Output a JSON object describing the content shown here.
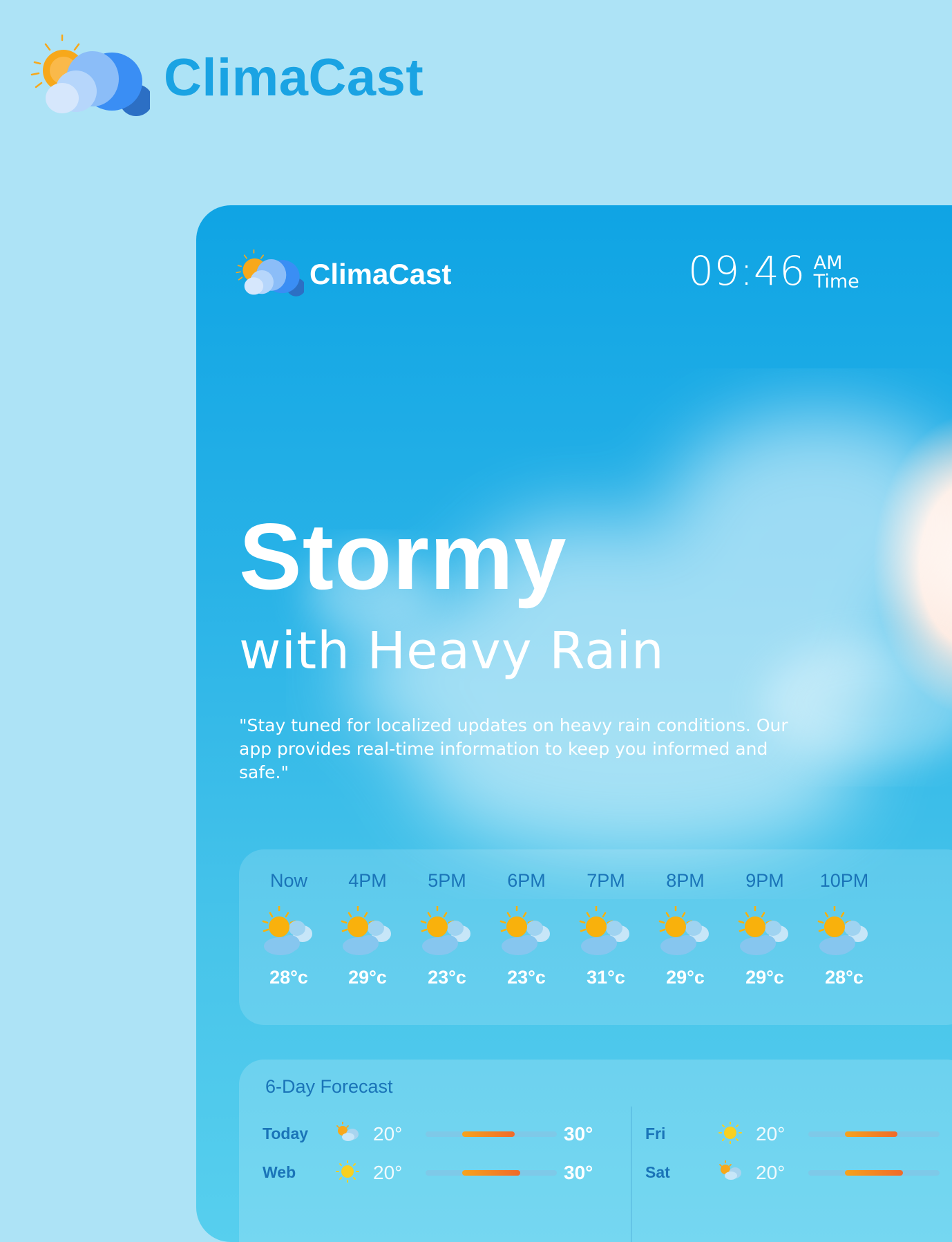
{
  "brand": {
    "name": "ClimaCast"
  },
  "app": {
    "name": "ClimaCast",
    "time": "09:46",
    "period": "AM",
    "time_label": "Time"
  },
  "hero": {
    "condition": "Stormy",
    "subcondition": "with Heavy Rain",
    "quote": "\"Stay tuned for localized updates on heavy rain conditions. Our app provides real-time information to keep you informed and safe.\""
  },
  "hourly": [
    {
      "label": "Now",
      "temp": "28°c",
      "icon": "sun-cloud-icon"
    },
    {
      "label": "4PM",
      "temp": "29°c",
      "icon": "sun-cloud-icon"
    },
    {
      "label": "5PM",
      "temp": "23°c",
      "icon": "sun-cloud-icon"
    },
    {
      "label": "6PM",
      "temp": "23°c",
      "icon": "sun-cloud-icon"
    },
    {
      "label": "7PM",
      "temp": "31°c",
      "icon": "sun-cloud-icon"
    },
    {
      "label": "8PM",
      "temp": "29°c",
      "icon": "sun-cloud-icon"
    },
    {
      "label": "9PM",
      "temp": "29°c",
      "icon": "sun-cloud-icon"
    },
    {
      "label": "10PM",
      "temp": "28°c",
      "icon": "sun-cloud-icon"
    }
  ],
  "forecast": {
    "title": "6-Day Forecast",
    "days": [
      {
        "day": "Today",
        "low": "20°",
        "high": "30°",
        "icon": "partly-cloudy-icon",
        "range": [
          0.28,
          0.68
        ]
      },
      {
        "day": "Web",
        "low": "20°",
        "high": "30°",
        "icon": "sun-icon",
        "range": [
          0.28,
          0.72
        ]
      },
      {
        "day": "Fri",
        "low": "20°",
        "high": "",
        "icon": "sun-icon",
        "range": [
          0.28,
          0.68
        ]
      },
      {
        "day": "Sat",
        "low": "20°",
        "high": "",
        "icon": "partly-cloudy-icon",
        "range": [
          0.28,
          0.72
        ]
      }
    ]
  },
  "colors": {
    "page_bg": "#ade3f6",
    "brand_blue": "#1aa3e3",
    "label_blue": "#1a74b8",
    "sun": "#f9b10c",
    "bar_hot": "#f06a2a"
  }
}
